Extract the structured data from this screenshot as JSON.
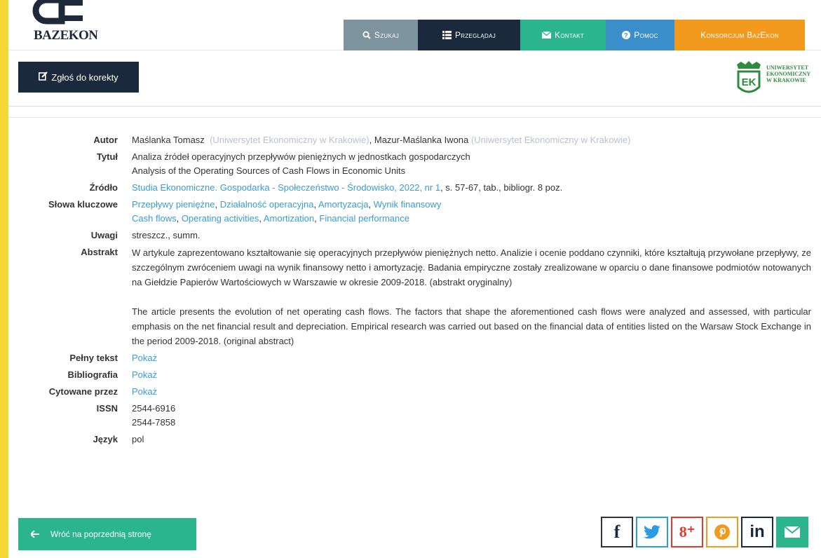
{
  "header": {
    "logo_text": "BAZEKON",
    "nav": [
      {
        "label": "Szukaj",
        "icon": "search-icon"
      },
      {
        "label": "Przeglądaj",
        "icon": "list-icon"
      },
      {
        "label": "Kontakt",
        "icon": "envelope-icon"
      },
      {
        "label": "Pomoc",
        "icon": "question-circle-icon"
      },
      {
        "label": "Konsorcjum BazEkon"
      }
    ]
  },
  "subbar": {
    "report_label": "Zgłoś do korekty",
    "university_text": [
      "UNIWERSYTET",
      "EKONOMICZNY",
      "W KRAKOWIE"
    ]
  },
  "details": {
    "autor": {
      "label": "Autor",
      "author1": "Maślanka Tomasz",
      "affil1": "(Uniwersytet Ekonomiczny w Krakowie)",
      "sep": ", ",
      "author2": "Mazur-Maślanka Iwona",
      "affil2": "(Uniwersytet Ekonomiczny w Krakowie)"
    },
    "tytul": {
      "label": "Tytuł",
      "pl": "Analiza źródeł operacyjnych przepływów pieniężnych w jednostkach gospodarczych",
      "en": "Analysis of the Operating Sources of Cash Flows in Economic Units"
    },
    "zrodlo": {
      "label": "Źródło",
      "journal": "Studia Ekonomiczne. Gospodarka - Społeczeństwo - Środowisko",
      "issue": "2022, nr 1",
      "rest": ", s. 57-67, tab., bibliogr. 8 poz."
    },
    "slowa": {
      "label": "Słowa kluczowe",
      "pl": [
        "Przepływy pieniężne",
        "Działalność operacyjna",
        "Amortyzacja",
        "Wynik finansowy"
      ],
      "en": [
        "Cash flows",
        "Operating activities",
        "Amortization",
        "Financial performance"
      ]
    },
    "uwagi": {
      "label": "Uwagi",
      "value": "streszcz., summ."
    },
    "abstrakt": {
      "label": "Abstrakt",
      "pl": "W artykule zaprezentowano kształtowanie się operacyjnych przepływów pieniężnych netto. Analizie i ocenie poddano czynniki, które kształtują przywołane przepływy, ze szczególnym zwróceniem uwagi na wynik finansowy netto i amortyzację. Badania empiryczne zostały zrealizowane w oparciu o dane finansowe podmiotów notowanych na Giełdzie Papierów Wartościowych w Warszawie w okresie 2009-2018. (abstrakt oryginalny)",
      "en": "The article presents the evolution of net operating cash flows. The factors that shape the aforementioned cash flows were analyzed and assessed, with particular emphasis on the net financial result and depreciation. Empirical research was carried out based on the financial data of entities listed on the Warsaw Stock Exchange in the period 2009-2018. (original abstract)"
    },
    "pelny": {
      "label": "Pełny tekst",
      "link": "Pokaż"
    },
    "biblio": {
      "label": "Bibliografia",
      "link": "Pokaż"
    },
    "cytowane": {
      "label": "Cytowane przez",
      "link": "Pokaż"
    },
    "issn": {
      "label": "ISSN",
      "values": [
        "2544-6916",
        "2544-7858"
      ]
    },
    "jezyk": {
      "label": "Język",
      "value": "pol"
    }
  },
  "footer": {
    "back_label": "Wróć na poprzednią stronę",
    "social": [
      {
        "name": "facebook-icon",
        "glyph": "f"
      },
      {
        "name": "twitter-icon"
      },
      {
        "name": "google-plus-icon",
        "glyph": "8⁺"
      },
      {
        "name": "pinterest-icon"
      },
      {
        "name": "linkedin-icon",
        "glyph": "in"
      },
      {
        "name": "email-icon"
      }
    ]
  },
  "colors": {
    "navy": "#1a2a3c",
    "green": "#2bb58c",
    "blue": "#3a8ec9",
    "orange": "#f29a1d",
    "gray": "#7d949e",
    "link": "#3a9bd9"
  }
}
